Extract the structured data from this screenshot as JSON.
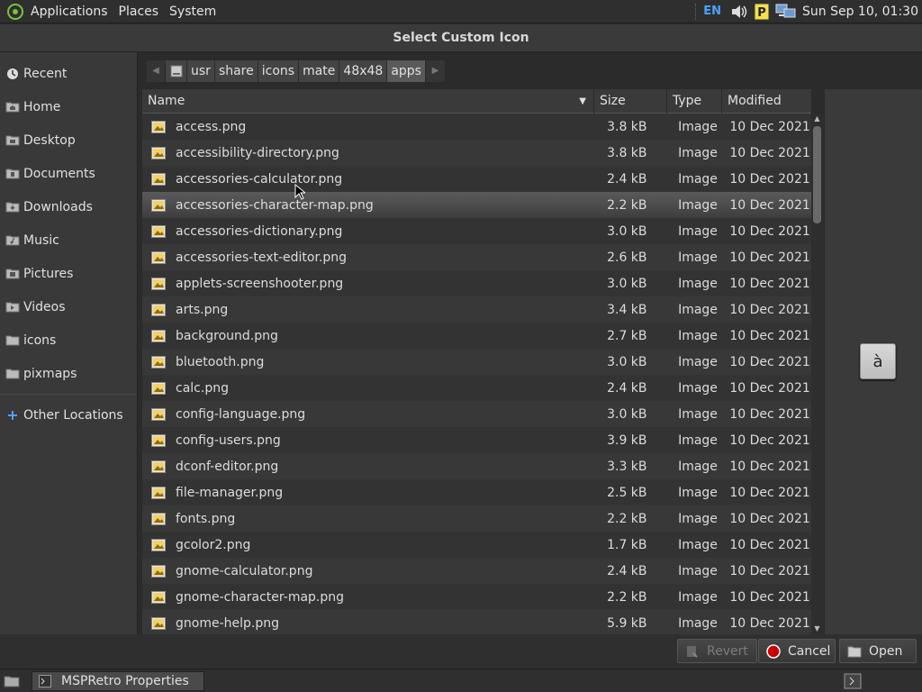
{
  "top_panel": {
    "menus": [
      "Applications",
      "Places",
      "System"
    ],
    "keyboard_layout": "EN",
    "clock": "Sun Sep 10, 01:30"
  },
  "dialog": {
    "title": "Select Custom Icon"
  },
  "sidebar": {
    "places": [
      {
        "label": "Recent",
        "icon": "recent-icon"
      },
      {
        "label": "Home",
        "icon": "home-folder-icon"
      },
      {
        "label": "Desktop",
        "icon": "desktop-folder-icon"
      },
      {
        "label": "Documents",
        "icon": "documents-folder-icon"
      },
      {
        "label": "Downloads",
        "icon": "downloads-folder-icon"
      },
      {
        "label": "Music",
        "icon": "music-folder-icon"
      },
      {
        "label": "Pictures",
        "icon": "pictures-folder-icon"
      },
      {
        "label": "Videos",
        "icon": "videos-folder-icon"
      },
      {
        "label": "icons",
        "icon": "folder-icon"
      },
      {
        "label": "pixmaps",
        "icon": "folder-icon"
      }
    ],
    "other_locations": "Other Locations"
  },
  "path": {
    "crumbs": [
      "usr",
      "share",
      "icons",
      "mate",
      "48x48",
      "apps"
    ],
    "active": "apps"
  },
  "table": {
    "columns": {
      "name": "Name",
      "size": "Size",
      "type": "Type",
      "modified": "Modified"
    },
    "selected_index": 3,
    "rows": [
      {
        "name": "access.png",
        "size": "3.8 kB",
        "type": "Image",
        "modified": "10 Dec 2021"
      },
      {
        "name": "accessibility-directory.png",
        "size": "3.8 kB",
        "type": "Image",
        "modified": "10 Dec 2021"
      },
      {
        "name": "accessories-calculator.png",
        "size": "2.4 kB",
        "type": "Image",
        "modified": "10 Dec 2021"
      },
      {
        "name": "accessories-character-map.png",
        "size": "2.2 kB",
        "type": "Image",
        "modified": "10 Dec 2021"
      },
      {
        "name": "accessories-dictionary.png",
        "size": "3.0 kB",
        "type": "Image",
        "modified": "10 Dec 2021"
      },
      {
        "name": "accessories-text-editor.png",
        "size": "2.6 kB",
        "type": "Image",
        "modified": "10 Dec 2021"
      },
      {
        "name": "applets-screenshooter.png",
        "size": "3.0 kB",
        "type": "Image",
        "modified": "10 Dec 2021"
      },
      {
        "name": "arts.png",
        "size": "3.4 kB",
        "type": "Image",
        "modified": "10 Dec 2021"
      },
      {
        "name": "background.png",
        "size": "2.7 kB",
        "type": "Image",
        "modified": "10 Dec 2021"
      },
      {
        "name": "bluetooth.png",
        "size": "3.0 kB",
        "type": "Image",
        "modified": "10 Dec 2021"
      },
      {
        "name": "calc.png",
        "size": "2.4 kB",
        "type": "Image",
        "modified": "10 Dec 2021"
      },
      {
        "name": "config-language.png",
        "size": "3.0 kB",
        "type": "Image",
        "modified": "10 Dec 2021"
      },
      {
        "name": "config-users.png",
        "size": "3.9 kB",
        "type": "Image",
        "modified": "10 Dec 2021"
      },
      {
        "name": "dconf-editor.png",
        "size": "3.3 kB",
        "type": "Image",
        "modified": "10 Dec 2021"
      },
      {
        "name": "file-manager.png",
        "size": "2.5 kB",
        "type": "Image",
        "modified": "10 Dec 2021"
      },
      {
        "name": "fonts.png",
        "size": "2.2 kB",
        "type": "Image",
        "modified": "10 Dec 2021"
      },
      {
        "name": "gcolor2.png",
        "size": "1.7 kB",
        "type": "Image",
        "modified": "10 Dec 2021"
      },
      {
        "name": "gnome-calculator.png",
        "size": "2.4 kB",
        "type": "Image",
        "modified": "10 Dec 2021"
      },
      {
        "name": "gnome-character-map.png",
        "size": "2.2 kB",
        "type": "Image",
        "modified": "10 Dec 2021"
      },
      {
        "name": "gnome-help.png",
        "size": "5.9 kB",
        "type": "Image",
        "modified": "10 Dec 2021"
      }
    ]
  },
  "preview": {
    "character": "à"
  },
  "buttons": {
    "revert": "Revert",
    "cancel": "Cancel",
    "open": "Open"
  },
  "taskbar": {
    "window_title": "MSPRetro Properties"
  },
  "colors": {
    "accent_blue": "#4aa3ff",
    "cancel_red": "#cc0000",
    "background": "#2b2b2b"
  }
}
